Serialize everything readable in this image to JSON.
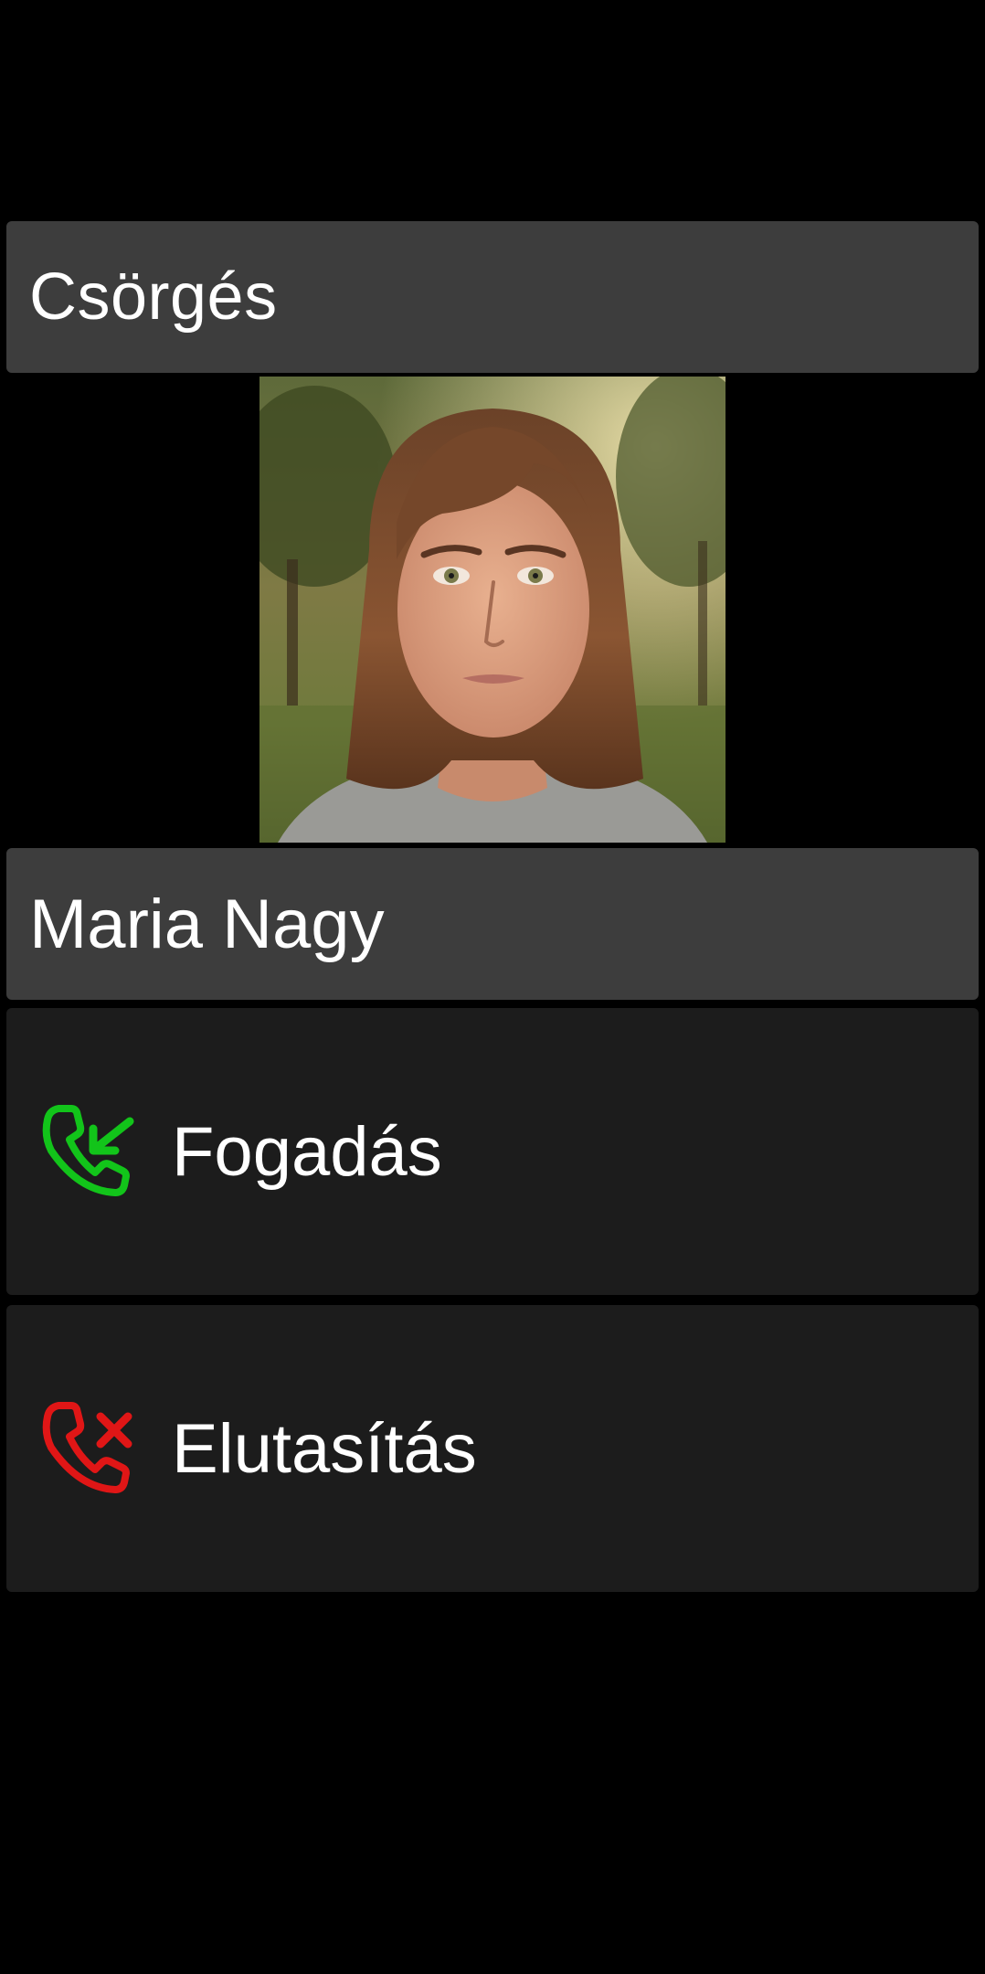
{
  "header": {
    "title": "Csörgés"
  },
  "caller": {
    "name": "Maria Nagy",
    "photo": "caller-photo"
  },
  "actions": {
    "accept": {
      "label": "Fogadás",
      "icon": "phone-incoming-icon",
      "color": "#12c41a"
    },
    "reject": {
      "label": "Elutasítás",
      "icon": "phone-reject-icon",
      "color": "#e01616"
    }
  },
  "colors": {
    "background": "#000000",
    "bar": "#3d3d3d",
    "button": "#1c1c1c",
    "text": "#ffffff"
  }
}
